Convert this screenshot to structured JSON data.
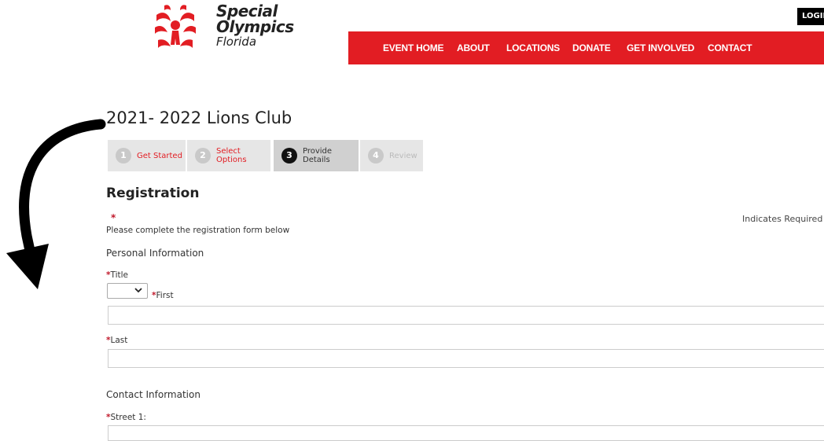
{
  "header": {
    "logo": {
      "line1": "Special",
      "line2": "Olympics",
      "line3": "Florida"
    },
    "login_label": "LOGIN",
    "nav": [
      "EVENT HOME",
      "ABOUT",
      "LOCATIONS",
      "DONATE",
      "GET INVOLVED",
      "CONTACT"
    ]
  },
  "event_title": "2021- 2022 Lions Club",
  "steps": [
    {
      "number": "1",
      "label": "Get Started",
      "state": "complete"
    },
    {
      "number": "2",
      "label": "Select Options",
      "state": "complete"
    },
    {
      "number": "3",
      "label": "Provide Details",
      "state": "active"
    },
    {
      "number": "4",
      "label": "Review",
      "state": "disabled"
    }
  ],
  "form": {
    "heading": "Registration",
    "required_star": "*",
    "indicates_required": "Indicates Required",
    "instructions": "Please complete the registration form below",
    "personal_heading": "Personal Information",
    "title_label": "Title",
    "title_value": "",
    "first_label": "First",
    "first_value": "",
    "last_label": "Last",
    "last_value": "",
    "contact_heading": "Contact Information",
    "street1_label": "Street 1:",
    "street1_value": ""
  },
  "colors": {
    "brand_red": "#e21d23",
    "required_red": "#c0182a"
  },
  "icons": {
    "logo": "special-olympics-logo-icon",
    "select_caret": "chevron-down-icon",
    "annotation": "curved-arrow-icon"
  }
}
